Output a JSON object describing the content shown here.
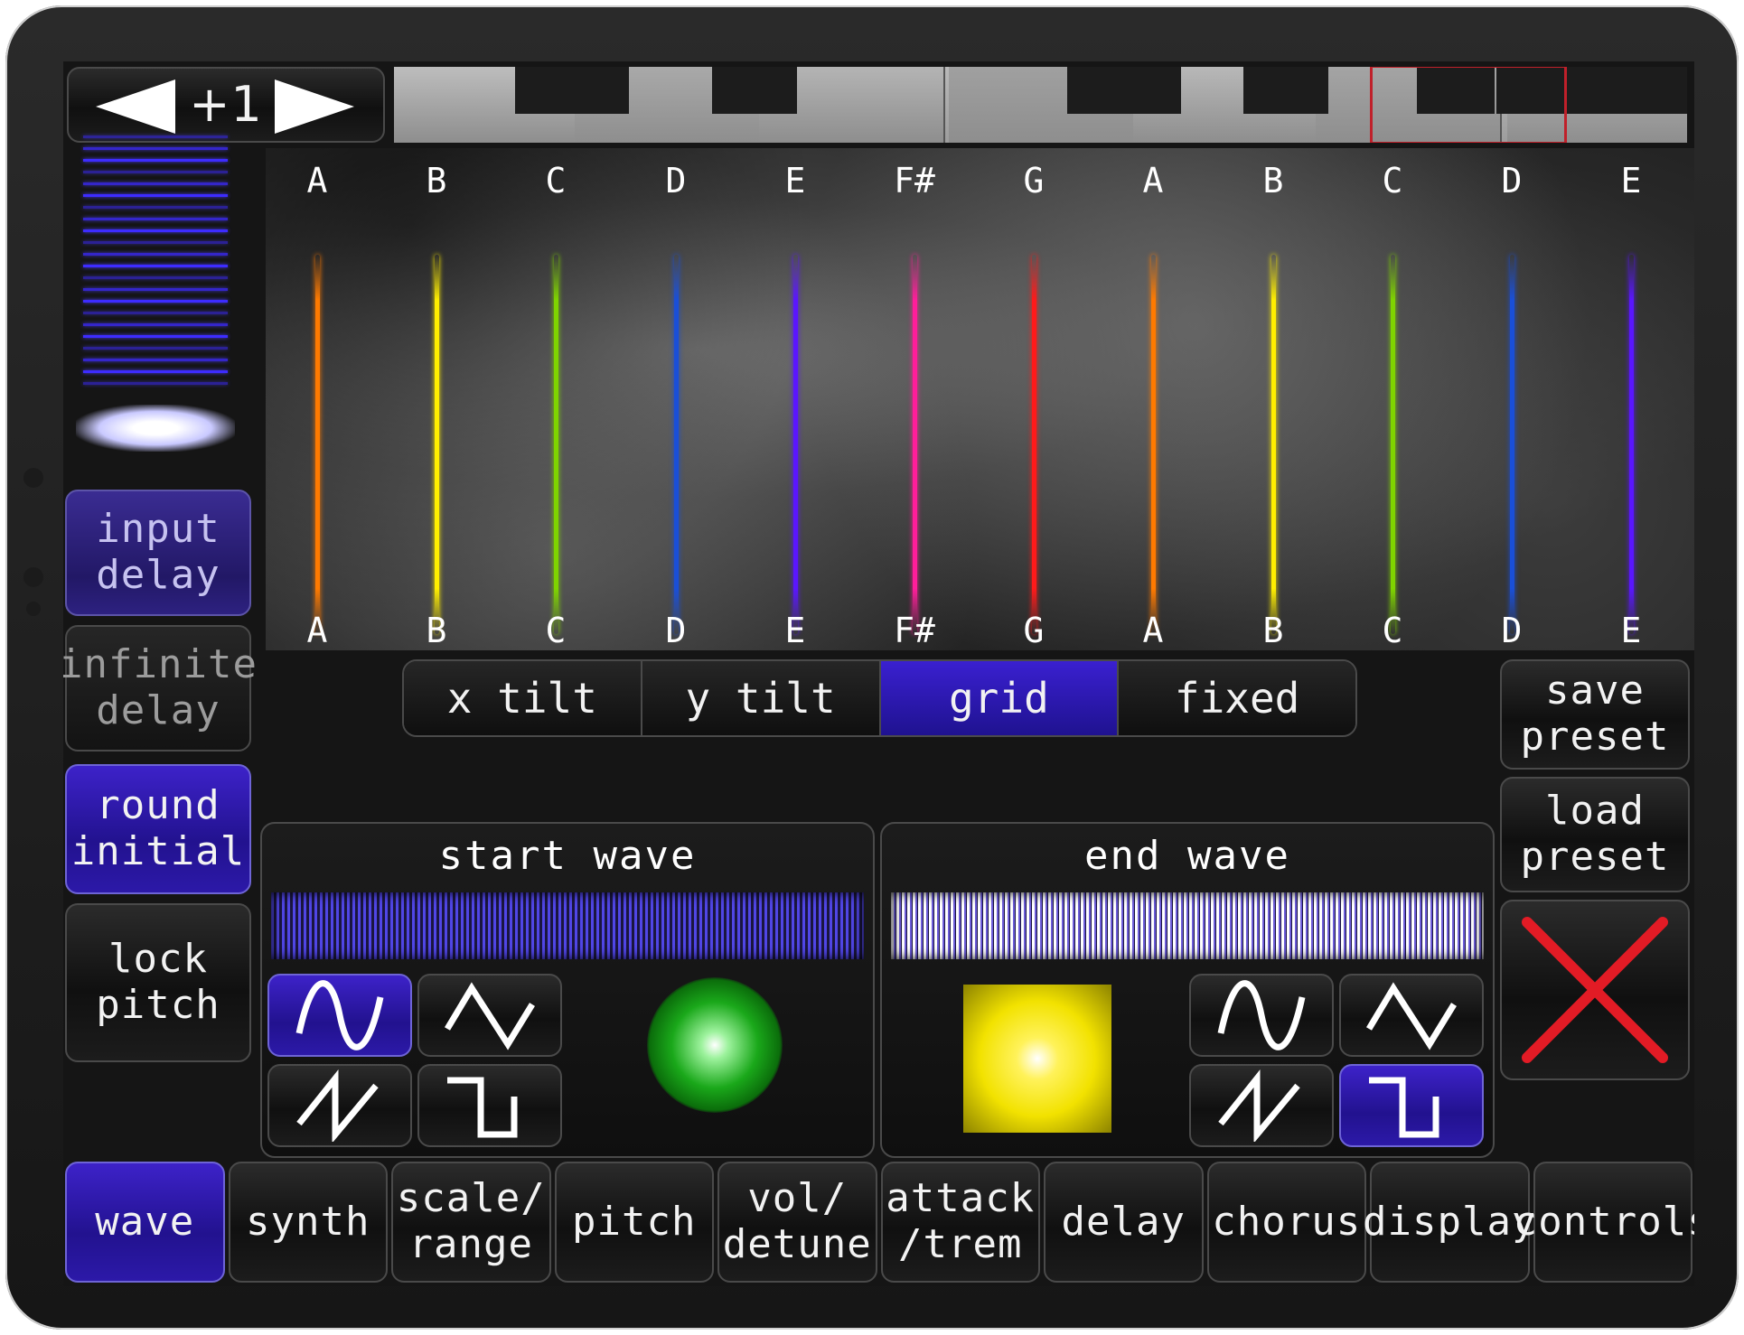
{
  "nav": {
    "value": "+1",
    "prev_icon": "left-triangle-icon",
    "next_icon": "right-triangle-icon"
  },
  "strings": {
    "notes": [
      "A",
      "B",
      "C",
      "D",
      "E",
      "F#",
      "G",
      "A",
      "B",
      "C",
      "D",
      "E"
    ],
    "colors": [
      "#ff7a00",
      "#ffee00",
      "#7fd400",
      "#1a4fd8",
      "#5a16ff",
      "#ff1e9a",
      "#ff1a1a",
      "#ff7a00",
      "#ffee00",
      "#7fd400",
      "#1a4fd8",
      "#5a16ff"
    ]
  },
  "side": {
    "input_delay": "input\ndelay",
    "infinite_delay": "infinite\ndelay",
    "round_initial": "round\ninitial",
    "lock_pitch": "lock\npitch"
  },
  "modes": {
    "x_tilt": "x tilt",
    "y_tilt": "y tilt",
    "grid": "grid",
    "fixed": "fixed",
    "selected": "grid"
  },
  "presets": {
    "save": "save\npreset",
    "load": "load\npreset",
    "close_icon": "close-x-icon"
  },
  "start_wave": {
    "title": "start wave",
    "selected": "sine"
  },
  "end_wave": {
    "title": "end wave",
    "selected": "square"
  },
  "tabs": [
    "wave",
    "synth",
    "scale/\nrange",
    "pitch",
    "vol/\ndetune",
    "attack\n/trem",
    "delay",
    "chorus",
    "display",
    "controls"
  ],
  "selected_tab": "wave",
  "colors": {
    "accent": "#2c17b0",
    "close": "#e21b25",
    "green_dot": "#1aa81a",
    "yellow_square": "#ffee00"
  }
}
